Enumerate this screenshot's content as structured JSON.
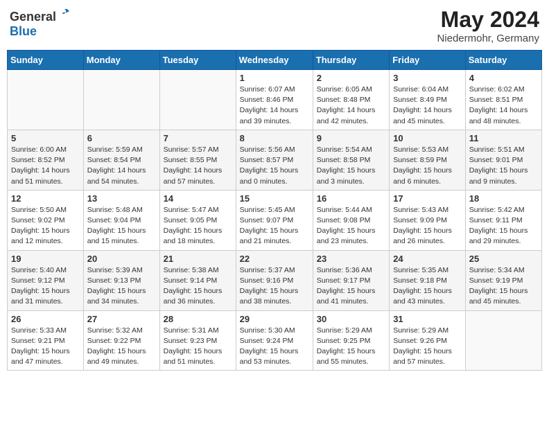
{
  "logo": {
    "general": "General",
    "blue": "Blue"
  },
  "title": "May 2024",
  "location": "Niedermohr, Germany",
  "days_of_week": [
    "Sunday",
    "Monday",
    "Tuesday",
    "Wednesday",
    "Thursday",
    "Friday",
    "Saturday"
  ],
  "weeks": [
    [
      {
        "day": "",
        "content": ""
      },
      {
        "day": "",
        "content": ""
      },
      {
        "day": "",
        "content": ""
      },
      {
        "day": "1",
        "content": "Sunrise: 6:07 AM\nSunset: 8:46 PM\nDaylight: 14 hours\nand 39 minutes."
      },
      {
        "day": "2",
        "content": "Sunrise: 6:05 AM\nSunset: 8:48 PM\nDaylight: 14 hours\nand 42 minutes."
      },
      {
        "day": "3",
        "content": "Sunrise: 6:04 AM\nSunset: 8:49 PM\nDaylight: 14 hours\nand 45 minutes."
      },
      {
        "day": "4",
        "content": "Sunrise: 6:02 AM\nSunset: 8:51 PM\nDaylight: 14 hours\nand 48 minutes."
      }
    ],
    [
      {
        "day": "5",
        "content": "Sunrise: 6:00 AM\nSunset: 8:52 PM\nDaylight: 14 hours\nand 51 minutes."
      },
      {
        "day": "6",
        "content": "Sunrise: 5:59 AM\nSunset: 8:54 PM\nDaylight: 14 hours\nand 54 minutes."
      },
      {
        "day": "7",
        "content": "Sunrise: 5:57 AM\nSunset: 8:55 PM\nDaylight: 14 hours\nand 57 minutes."
      },
      {
        "day": "8",
        "content": "Sunrise: 5:56 AM\nSunset: 8:57 PM\nDaylight: 15 hours\nand 0 minutes."
      },
      {
        "day": "9",
        "content": "Sunrise: 5:54 AM\nSunset: 8:58 PM\nDaylight: 15 hours\nand 3 minutes."
      },
      {
        "day": "10",
        "content": "Sunrise: 5:53 AM\nSunset: 8:59 PM\nDaylight: 15 hours\nand 6 minutes."
      },
      {
        "day": "11",
        "content": "Sunrise: 5:51 AM\nSunset: 9:01 PM\nDaylight: 15 hours\nand 9 minutes."
      }
    ],
    [
      {
        "day": "12",
        "content": "Sunrise: 5:50 AM\nSunset: 9:02 PM\nDaylight: 15 hours\nand 12 minutes."
      },
      {
        "day": "13",
        "content": "Sunrise: 5:48 AM\nSunset: 9:04 PM\nDaylight: 15 hours\nand 15 minutes."
      },
      {
        "day": "14",
        "content": "Sunrise: 5:47 AM\nSunset: 9:05 PM\nDaylight: 15 hours\nand 18 minutes."
      },
      {
        "day": "15",
        "content": "Sunrise: 5:45 AM\nSunset: 9:07 PM\nDaylight: 15 hours\nand 21 minutes."
      },
      {
        "day": "16",
        "content": "Sunrise: 5:44 AM\nSunset: 9:08 PM\nDaylight: 15 hours\nand 23 minutes."
      },
      {
        "day": "17",
        "content": "Sunrise: 5:43 AM\nSunset: 9:09 PM\nDaylight: 15 hours\nand 26 minutes."
      },
      {
        "day": "18",
        "content": "Sunrise: 5:42 AM\nSunset: 9:11 PM\nDaylight: 15 hours\nand 29 minutes."
      }
    ],
    [
      {
        "day": "19",
        "content": "Sunrise: 5:40 AM\nSunset: 9:12 PM\nDaylight: 15 hours\nand 31 minutes."
      },
      {
        "day": "20",
        "content": "Sunrise: 5:39 AM\nSunset: 9:13 PM\nDaylight: 15 hours\nand 34 minutes."
      },
      {
        "day": "21",
        "content": "Sunrise: 5:38 AM\nSunset: 9:14 PM\nDaylight: 15 hours\nand 36 minutes."
      },
      {
        "day": "22",
        "content": "Sunrise: 5:37 AM\nSunset: 9:16 PM\nDaylight: 15 hours\nand 38 minutes."
      },
      {
        "day": "23",
        "content": "Sunrise: 5:36 AM\nSunset: 9:17 PM\nDaylight: 15 hours\nand 41 minutes."
      },
      {
        "day": "24",
        "content": "Sunrise: 5:35 AM\nSunset: 9:18 PM\nDaylight: 15 hours\nand 43 minutes."
      },
      {
        "day": "25",
        "content": "Sunrise: 5:34 AM\nSunset: 9:19 PM\nDaylight: 15 hours\nand 45 minutes."
      }
    ],
    [
      {
        "day": "26",
        "content": "Sunrise: 5:33 AM\nSunset: 9:21 PM\nDaylight: 15 hours\nand 47 minutes."
      },
      {
        "day": "27",
        "content": "Sunrise: 5:32 AM\nSunset: 9:22 PM\nDaylight: 15 hours\nand 49 minutes."
      },
      {
        "day": "28",
        "content": "Sunrise: 5:31 AM\nSunset: 9:23 PM\nDaylight: 15 hours\nand 51 minutes."
      },
      {
        "day": "29",
        "content": "Sunrise: 5:30 AM\nSunset: 9:24 PM\nDaylight: 15 hours\nand 53 minutes."
      },
      {
        "day": "30",
        "content": "Sunrise: 5:29 AM\nSunset: 9:25 PM\nDaylight: 15 hours\nand 55 minutes."
      },
      {
        "day": "31",
        "content": "Sunrise: 5:29 AM\nSunset: 9:26 PM\nDaylight: 15 hours\nand 57 minutes."
      },
      {
        "day": "",
        "content": ""
      }
    ]
  ]
}
